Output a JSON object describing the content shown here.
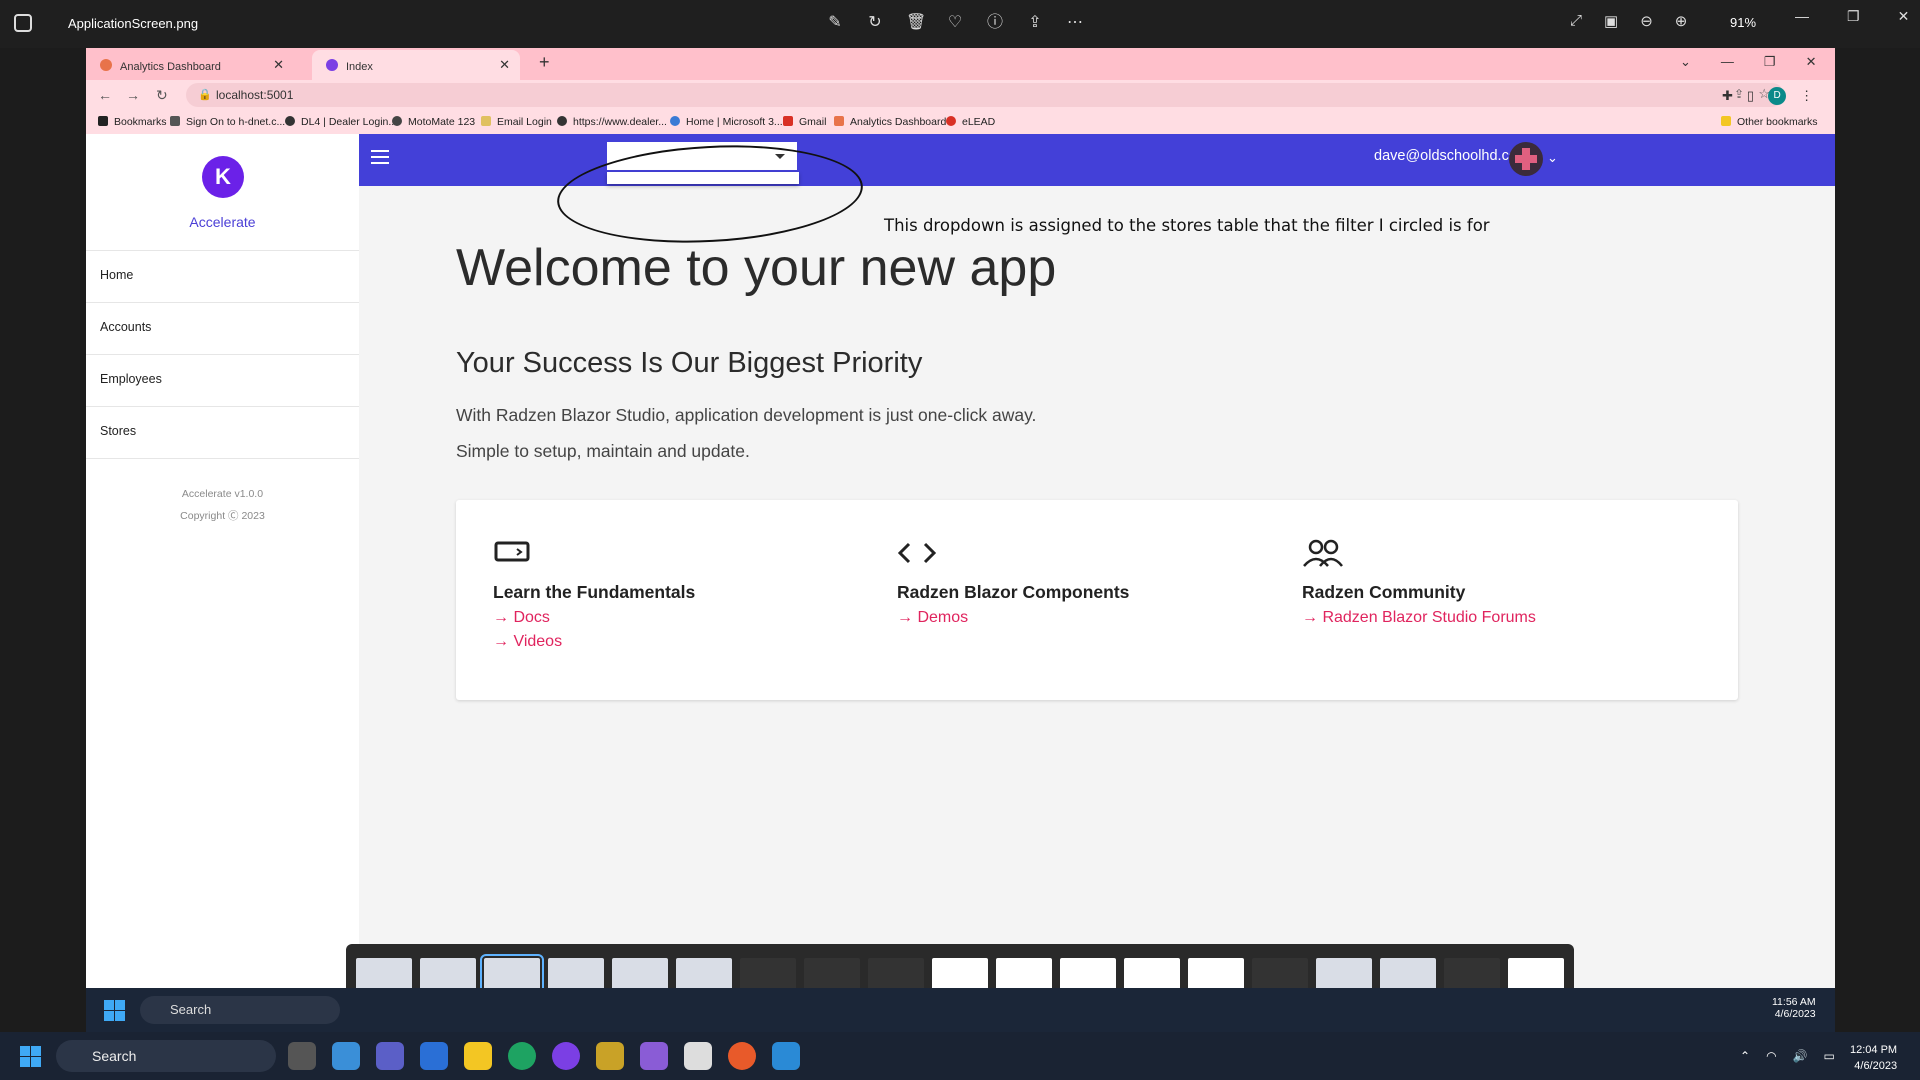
{
  "viewer": {
    "filename": "ApplicationScreen.png",
    "zoom": "91%"
  },
  "browser": {
    "tabs": [
      {
        "label": "Analytics Dashboard",
        "active": false
      },
      {
        "label": "Index",
        "active": true
      }
    ],
    "url": "localhost:5001",
    "profile_initial": "D",
    "bookmarks": [
      "Bookmarks",
      "Sign On to h-dnet.c...",
      "DL4 | Dealer Login...",
      "MotoMate 123",
      "Email Login",
      "https://www.dealer...",
      "Home | Microsoft 3...",
      "Gmail",
      "Analytics Dashboard",
      "eLEAD"
    ],
    "other_bookmarks": "Other bookmarks"
  },
  "app": {
    "brand": "Accelerate",
    "logo_letter": "K",
    "nav": [
      "Home",
      "Accounts",
      "Employees",
      "Stores"
    ],
    "version": "Accelerate v1.0.0",
    "copyright": "Copyright Ⓒ 2023",
    "header": {
      "dropdown_value": "",
      "user_email": "dave@oldschoolhd.com"
    },
    "annotation": "This dropdown is assigned to the stores table that the filter I circled is for",
    "welcome": "Welcome to your new app",
    "priority": "Your Success Is Our Biggest Priority",
    "para1": "With Radzen Blazor Studio, application development is just one-click away.",
    "para2": "Simple to setup, maintain and update.",
    "cards": [
      {
        "title": "Learn the Fundamentals",
        "icon": "laptop-icon",
        "links": [
          "→ Docs",
          "→ Videos"
        ]
      },
      {
        "title": "Radzen Blazor Components",
        "icon": "code-icon",
        "links": [
          "→ Demos"
        ]
      },
      {
        "title": "Radzen Community",
        "icon": "people-icon",
        "links": [
          "→ Radzen Blazor Studio Forums"
        ]
      }
    ]
  },
  "inner_taskbar": {
    "search": "Search",
    "time": "11:56 AM",
    "date": "4/6/2023"
  },
  "taskbar": {
    "search": "Search",
    "time": "12:04 PM",
    "date": "4/6/2023"
  },
  "colors": {
    "header": "#4340d8",
    "tab_strip": "#ffc0cb",
    "link": "#e0245e",
    "brand": "#4b3fd6"
  }
}
